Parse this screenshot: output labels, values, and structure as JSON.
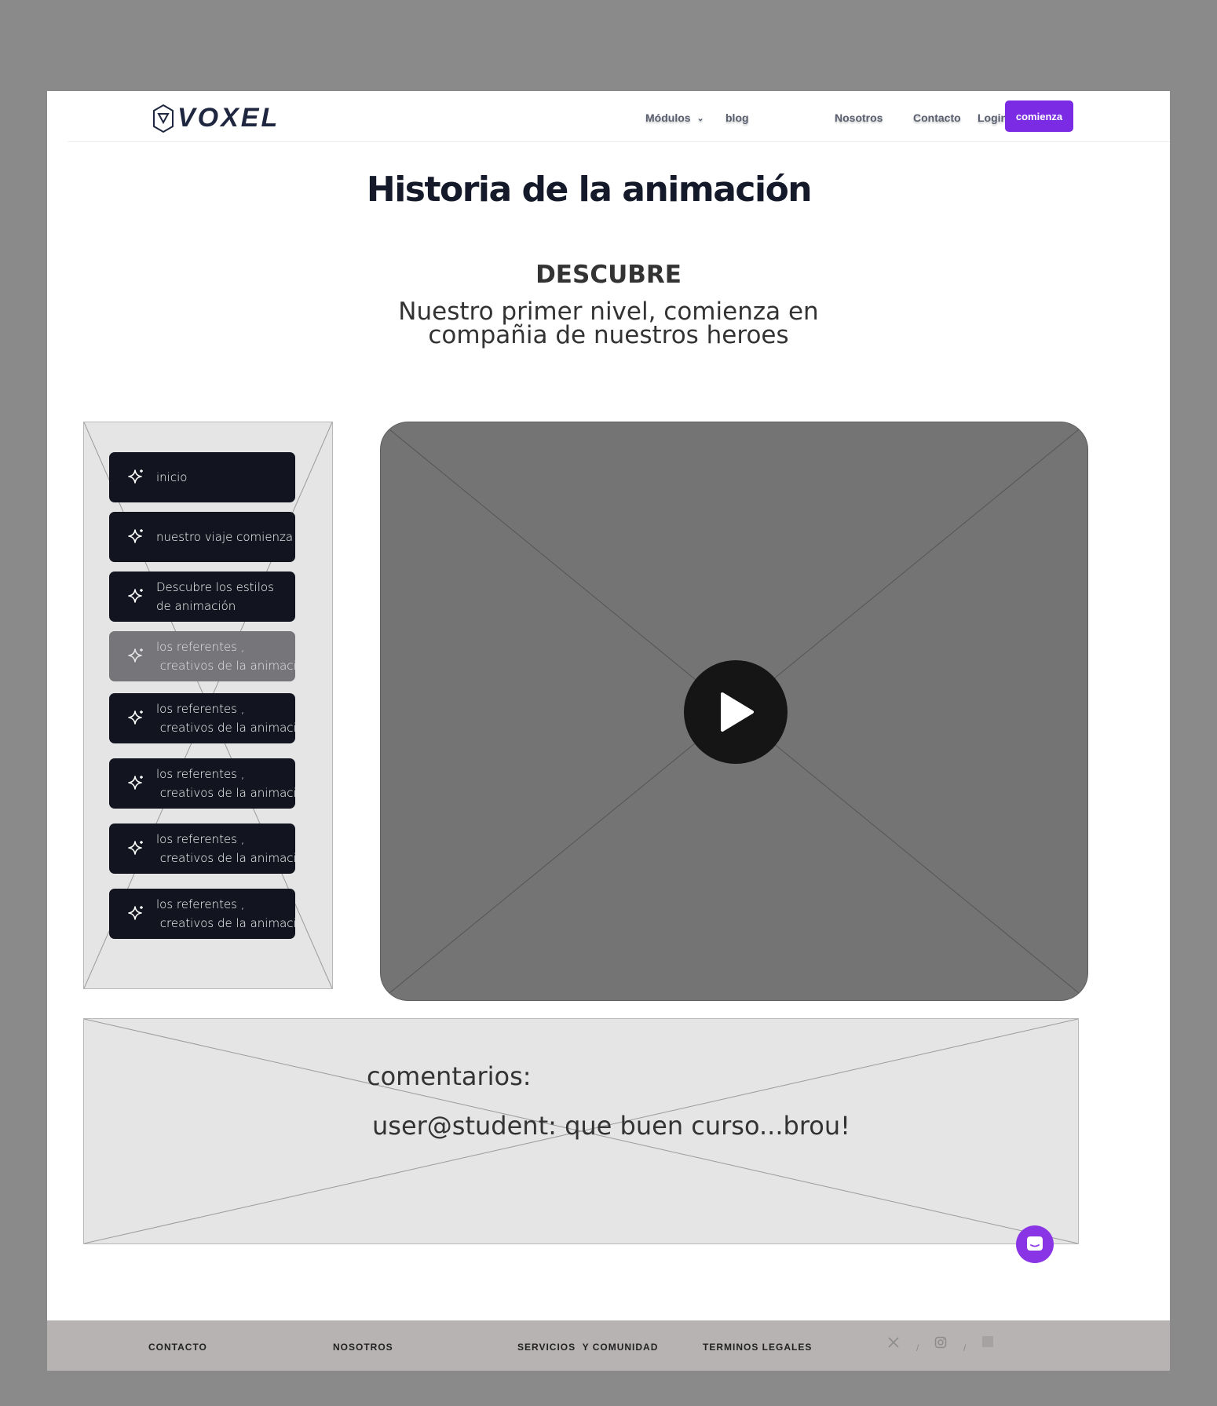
{
  "header": {
    "logo_text": "VOXEL",
    "nav": {
      "modulos": "Módulos",
      "blog": "blog",
      "nosotros": "Nosotros",
      "contacto": "Contacto",
      "login": "Login"
    },
    "cta": "comienza"
  },
  "hero": {
    "title": "Historia de la animación",
    "kicker": "DESCUBRE",
    "subtitle": "Nuestro primer nivel, comienza en compañia de nuestros heroes"
  },
  "sidebar": {
    "items": [
      {
        "label": "inicio",
        "active": true
      },
      {
        "label": "nuestro viaje comienza",
        "active": true
      },
      {
        "label": "Descubre los estilos\nde animación",
        "active": true
      },
      {
        "label": "los referentes ,\n creativos de la animación",
        "active": false
      },
      {
        "label": "los referentes ,\n creativos de la animación",
        "active": true
      },
      {
        "label": "los referentes ,\n creativos de la animación",
        "active": true
      },
      {
        "label": "los referentes ,\n creativos de la animación",
        "active": true
      },
      {
        "label": "los referentes ,\n creativos de la animación",
        "active": true
      }
    ]
  },
  "video": {
    "icon": "play-icon"
  },
  "comments": {
    "label": "comentarios:",
    "entries": [
      "user@student: que buen curso...brou!"
    ]
  },
  "footer": {
    "links": [
      "CONTACTO",
      "NOSOTROS",
      "SERVICIOS  Y COMUNIDAD",
      "TERMINOS LEGALES"
    ],
    "social": [
      "x-icon",
      "instagram-icon",
      "square-icon"
    ],
    "separator": "/"
  },
  "colors": {
    "accent": "#7b2be3",
    "sidebar_button": "#12141f",
    "footer_bg": "#b8b3b3",
    "video_bg": "#747474"
  }
}
